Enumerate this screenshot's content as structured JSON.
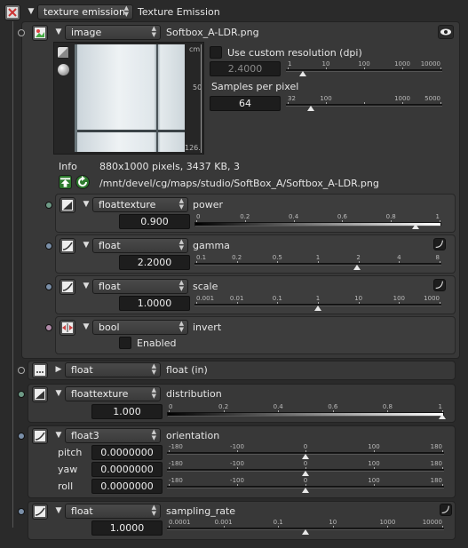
{
  "header": {
    "type_value": "texture emission",
    "title": "Texture Emission"
  },
  "image_node": {
    "type_value": "image",
    "filename": "Softbox_A-LDR.png",
    "ruler": {
      "unit": "cm",
      "mid": "50",
      "end": "126."
    },
    "custom_res_label": "Use custom resolution (dpi)",
    "custom_res_value": "2.4000",
    "custom_res_ticks": [
      "1",
      "10",
      "100",
      "1000",
      "10000"
    ],
    "samples_label": "Samples per pixel",
    "samples_value": "64",
    "samples_ticks": [
      "32",
      "100",
      "",
      "1000",
      "5000"
    ],
    "info_label": "Info",
    "info_text": "880x1000 pixels, 3437 KB, 3",
    "path": "/mnt/devel/cg/maps/studio/SoftBox_A/Softbox_A-LDR.png"
  },
  "power": {
    "type_value": "floattexture",
    "name": "power",
    "value": "0.900",
    "ticks": [
      "0",
      "0.2",
      "0.4",
      "0.6",
      "0.8",
      "1"
    ],
    "level": 0.9
  },
  "gamma": {
    "type_value": "float",
    "name": "gamma",
    "value": "2.2000",
    "ticks": [
      "0.1",
      "0.2",
      "0.5",
      "1",
      "2",
      "4",
      "8"
    ]
  },
  "scale": {
    "type_value": "float",
    "name": "scale",
    "value": "1.0000",
    "ticks": [
      "0.001",
      "0.01",
      "0.1",
      "1",
      "10",
      "100",
      "1000"
    ]
  },
  "invert": {
    "type_value": "bool",
    "name": "invert",
    "checkbox_label": "Enabled"
  },
  "float_in": {
    "type_value": "float",
    "name": "float (in)"
  },
  "distribution": {
    "type_value": "floattexture",
    "name": "distribution",
    "value": "1.000",
    "ticks": [
      "0",
      "0.2",
      "0.4",
      "0.6",
      "0.8",
      "1"
    ],
    "level": 1.0
  },
  "orientation": {
    "type_value": "float3",
    "name": "orientation",
    "rows": [
      {
        "label": "pitch",
        "value": "0.0000000"
      },
      {
        "label": "yaw",
        "value": "0.0000000"
      },
      {
        "label": "roll",
        "value": "0.0000000"
      }
    ],
    "ticks": [
      "-180",
      "-100",
      "0",
      "100",
      "180"
    ]
  },
  "sampling_rate": {
    "type_value": "float",
    "name": "sampling_rate",
    "value": "1.0000",
    "ticks": [
      "0.0001",
      "0.001",
      "0.1",
      "10",
      "1000",
      "10000"
    ]
  },
  "colors": {
    "float_dot": "#7a8fa8",
    "texture_dot": "#6e9a86",
    "bool_dot": "#b08aa8"
  }
}
